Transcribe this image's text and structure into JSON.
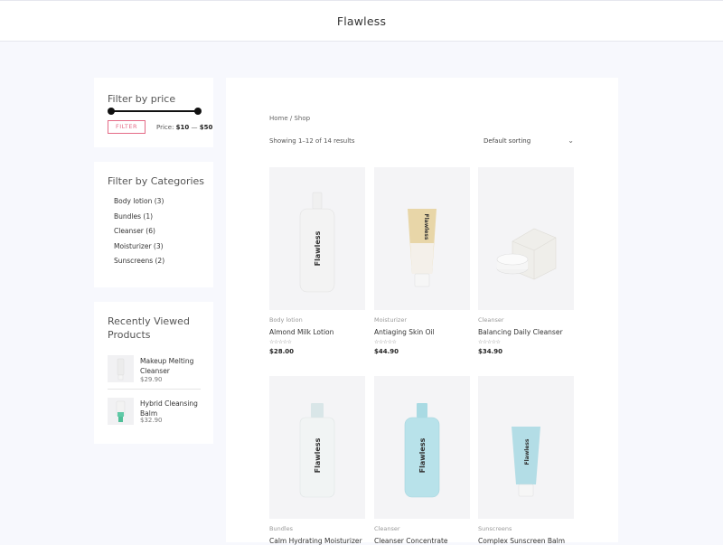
{
  "header": {
    "brand": "Flawless"
  },
  "sidebar": {
    "price_filter": {
      "title": "Filter by price",
      "button_label": "FILTER",
      "price_prefix": "Price:",
      "price_min": "$10",
      "price_sep": "—",
      "price_max": "$50",
      "range_min_fraction": 0,
      "range_max_fraction": 1
    },
    "categories": {
      "title": "Filter by Categories",
      "items": [
        {
          "label": "Body lotion (3)"
        },
        {
          "label": "Bundles (1)"
        },
        {
          "label": "Cleanser (6)"
        },
        {
          "label": "Moisturizer (3)"
        },
        {
          "label": "Sunscreens (2)"
        }
      ]
    },
    "recently_viewed": {
      "title": "Recently Viewed Products",
      "items": [
        {
          "name": "Makeup Melting Cleanser",
          "price": "$29.90"
        },
        {
          "name": "Hybrid Cleansing Balm",
          "price": "$32.90"
        }
      ]
    }
  },
  "shop": {
    "breadcrumb": "Home / Shop",
    "result_count": "Showing 1–12 of 14 results",
    "sorting": {
      "selected": "Default sorting"
    },
    "products": [
      {
        "category": "Body lotion",
        "name": "Almond Milk Lotion",
        "price": "$28.00",
        "rating": 0,
        "brand_label": "Flawless"
      },
      {
        "category": "Moisturizer",
        "name": "Antiaging Skin Oil",
        "price": "$44.90",
        "rating": 0,
        "brand_label": "Flawless"
      },
      {
        "category": "Cleanser",
        "name": "Balancing Daily Cleanser",
        "price": "$34.90",
        "rating": 0,
        "brand_label": "Flawless"
      },
      {
        "category": "Bundles",
        "name": "Calm Hydrating Moisturizer",
        "price": "",
        "rating": 0,
        "brand_label": "Flawless"
      },
      {
        "category": "Cleanser",
        "name": "Cleanser Concentrate",
        "price": "",
        "rating": 0,
        "brand_label": "Flawless"
      },
      {
        "category": "Sunscreens",
        "name": "Complex Sunscreen Balm",
        "price": "",
        "rating": 0,
        "brand_label": "Flawless"
      }
    ],
    "stars_glyph": "☆☆☆☆☆"
  },
  "colors": {
    "accent": "#e46a86",
    "background": "#f7f8fd"
  }
}
